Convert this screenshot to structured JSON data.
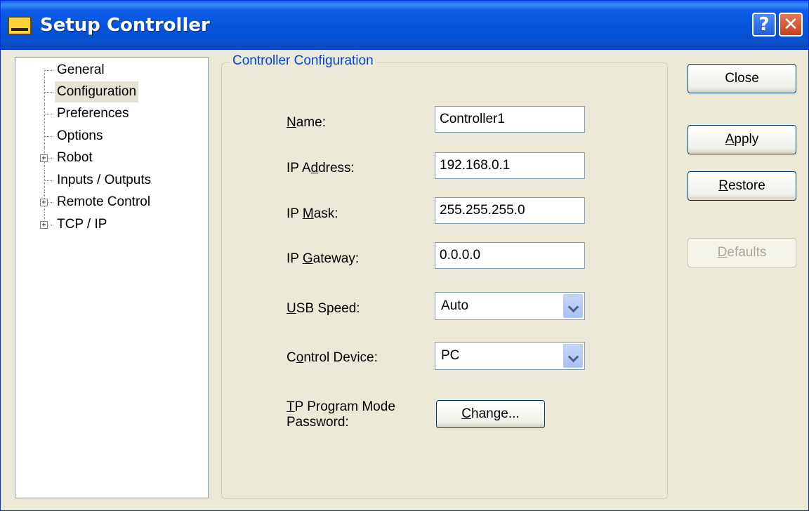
{
  "window": {
    "title": "Setup Controller"
  },
  "tree": {
    "items": [
      {
        "label": "General",
        "expandable": false,
        "selected": false
      },
      {
        "label": "Configuration",
        "expandable": false,
        "selected": true
      },
      {
        "label": "Preferences",
        "expandable": false,
        "selected": false
      },
      {
        "label": "Options",
        "expandable": false,
        "selected": false
      },
      {
        "label": "Robot",
        "expandable": true,
        "selected": false
      },
      {
        "label": "Inputs / Outputs",
        "expandable": false,
        "selected": false
      },
      {
        "label": "Remote Control",
        "expandable": true,
        "selected": false
      },
      {
        "label": "TCP / IP",
        "expandable": true,
        "selected": false
      }
    ],
    "expander_symbol": "+"
  },
  "group": {
    "title": "Controller Configuration"
  },
  "fields": {
    "name": {
      "label_pre": "",
      "label_key": "N",
      "label_post": "ame:",
      "value": "Controller1"
    },
    "ip_address": {
      "label_pre": "IP A",
      "label_key": "d",
      "label_post": "dress:",
      "value": "192.168.0.1"
    },
    "ip_mask": {
      "label_pre": "IP ",
      "label_key": "M",
      "label_post": "ask:",
      "value": "255.255.255.0"
    },
    "ip_gateway": {
      "label_pre": "IP ",
      "label_key": "G",
      "label_post": "ateway:",
      "value": "0.0.0.0"
    },
    "usb_speed": {
      "label_pre": "",
      "label_key": "U",
      "label_post": "SB Speed:",
      "value": "Auto"
    },
    "control_device": {
      "label_pre": "C",
      "label_key": "o",
      "label_post": "ntrol Device:",
      "value": "PC"
    },
    "tp_password": {
      "label_line1_key": "T",
      "label_line1_post": "P Program Mode",
      "label_line2": "Password:"
    }
  },
  "buttons": {
    "close": {
      "label": "Close"
    },
    "apply": {
      "key": "A",
      "rest": "pply"
    },
    "restore": {
      "key": "R",
      "rest": "estore"
    },
    "defaults": {
      "key": "D",
      "rest": "efaults",
      "enabled": false
    },
    "change": {
      "key": "C",
      "rest": "hange..."
    }
  }
}
